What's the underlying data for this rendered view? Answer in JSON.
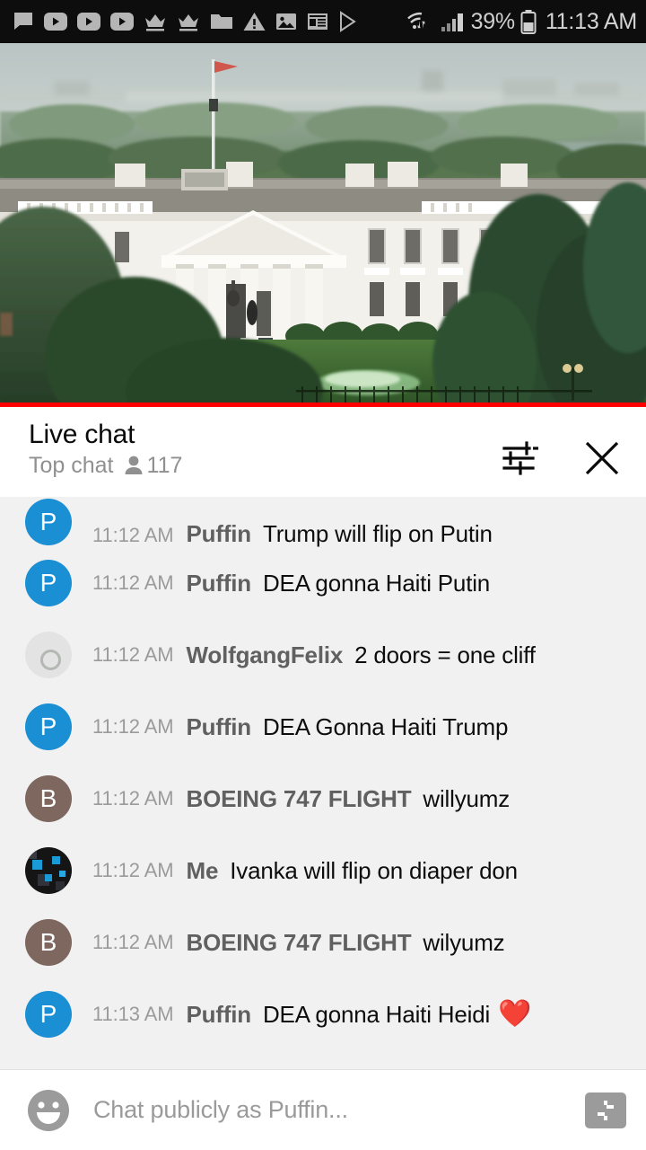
{
  "statusbar": {
    "icons": [
      {
        "name": "message-icon"
      },
      {
        "name": "youtube-icon-1"
      },
      {
        "name": "youtube-icon-2"
      },
      {
        "name": "youtube-icon-3"
      },
      {
        "name": "crown-icon-1"
      },
      {
        "name": "crown-icon-2"
      },
      {
        "name": "folder-icon"
      },
      {
        "name": "warning-icon"
      },
      {
        "name": "image-icon"
      },
      {
        "name": "news-icon"
      },
      {
        "name": "play-store-icon"
      }
    ],
    "wifi_icon": "wifi-icon",
    "signal_icon": "cellular-signal-icon",
    "battery_percent": "39%",
    "battery_icon": "battery-icon",
    "clock": "11:13 AM"
  },
  "player": {
    "name": "live-video-player",
    "scene": "white-house-live-stream",
    "progress_color": "#ff0000"
  },
  "chat_header": {
    "title": "Live chat",
    "mode": "Top chat",
    "viewer_icon": "person-icon",
    "viewer_count": "117",
    "filter_icon": "tune-filter-icon",
    "close_icon": "close-icon"
  },
  "messages": [
    {
      "avatar_type": "letter",
      "avatar_letter": "P",
      "avatar_color": "#1b8fd4",
      "time": "11:12 AM",
      "author": "Puffin",
      "text": "Trump will flip on Putin",
      "emoji": "",
      "partial": true
    },
    {
      "avatar_type": "letter",
      "avatar_letter": "P",
      "avatar_color": "#1b8fd4",
      "time": "11:12 AM",
      "author": "Puffin",
      "text": "DEA gonna Haiti Putin",
      "emoji": "",
      "partial": false
    },
    {
      "avatar_type": "photo-wolf",
      "avatar_letter": "",
      "avatar_color": "#e3e3e3",
      "time": "11:12 AM",
      "author": "WolfgangFelix",
      "text": "2 doors = one cliff",
      "emoji": "",
      "partial": false
    },
    {
      "avatar_type": "letter",
      "avatar_letter": "P",
      "avatar_color": "#1b8fd4",
      "time": "11:12 AM",
      "author": "Puffin",
      "text": "DEA Gonna Haiti Trump",
      "emoji": "",
      "partial": false
    },
    {
      "avatar_type": "letter",
      "avatar_letter": "B",
      "avatar_color": "#7d675f",
      "time": "11:12 AM",
      "author": "BOEING 747 FLIGHT",
      "text": "willyumz",
      "emoji": "",
      "partial": false
    },
    {
      "avatar_type": "photo-me",
      "avatar_letter": "",
      "avatar_color": "#151515",
      "time": "11:12 AM",
      "author": "Me",
      "text": "Ivanka will flip on diaper don",
      "emoji": "",
      "partial": false
    },
    {
      "avatar_type": "letter",
      "avatar_letter": "B",
      "avatar_color": "#7d675f",
      "time": "11:12 AM",
      "author": "BOEING 747 FLIGHT",
      "text": "wilyumz",
      "emoji": "",
      "partial": false
    },
    {
      "avatar_type": "letter",
      "avatar_letter": "P",
      "avatar_color": "#1b8fd4",
      "time": "11:13 AM",
      "author": "Puffin",
      "text": "DEA gonna Haiti Heidi",
      "emoji": "❤️",
      "partial": false
    }
  ],
  "composer": {
    "emoji_icon": "emoji-smiley-icon",
    "placeholder": "Chat publicly as Puffin...",
    "value": "",
    "superchat_icon": "super-chat-dollar-icon"
  }
}
